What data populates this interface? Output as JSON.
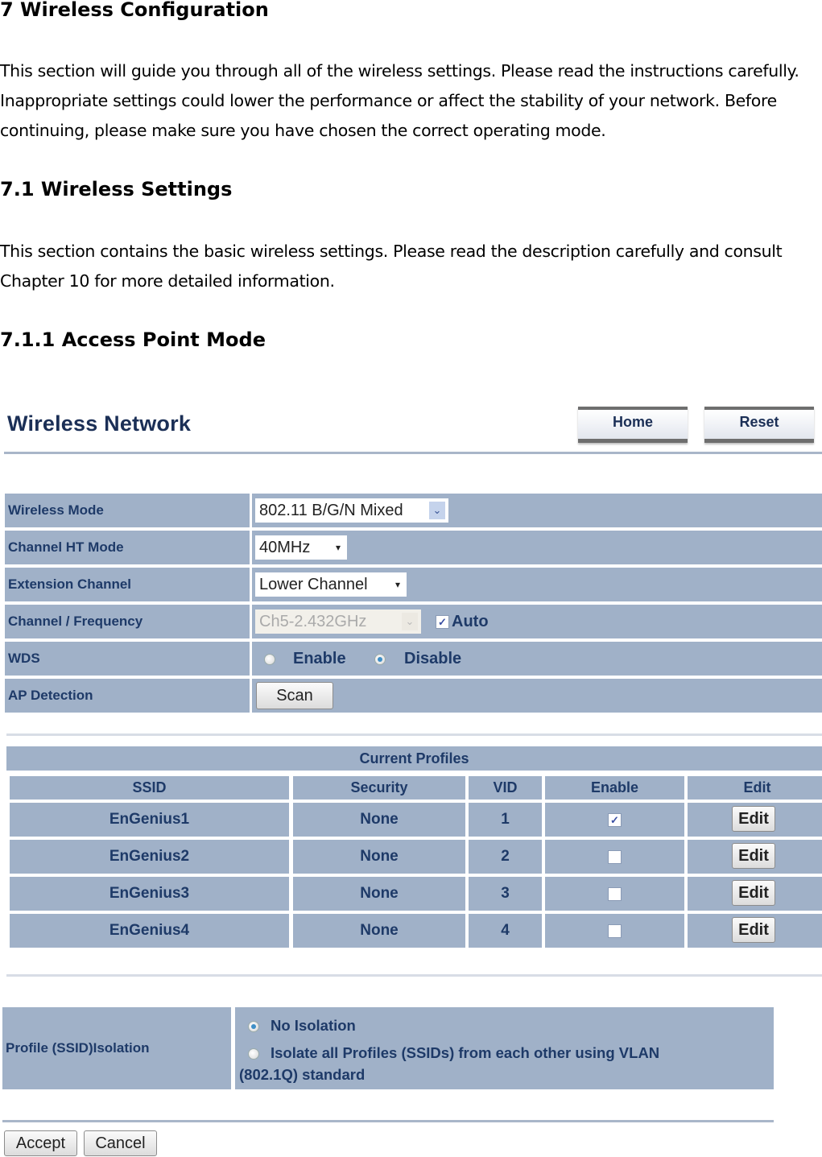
{
  "document": {
    "heading_1": "7 Wireless Configuration",
    "intro_paragraph": "This section will guide you through all of the wireless settings. Please read the instructions carefully. Inappropriate settings could lower the performance or affect the stability of your network. Before continuing, please make sure you have chosen the correct operating mode.",
    "heading_2": "7.1 Wireless Settings",
    "settings_paragraph": "This section contains the basic wireless settings. Please read the description carefully and consult Chapter 10 for more detailed information.",
    "heading_3": "7.1.1 Access Point Mode"
  },
  "ui": {
    "title": "Wireless Network",
    "header_buttons": {
      "home": "Home",
      "reset": "Reset"
    },
    "settings": {
      "wireless_mode": {
        "label": "Wireless Mode",
        "value": "802.11 B/G/N Mixed"
      },
      "channel_ht_mode": {
        "label": "Channel HT Mode",
        "value": "40MHz"
      },
      "extension_channel": {
        "label": "Extension Channel",
        "value": "Lower Channel"
      },
      "channel_frequency": {
        "label": "Channel / Frequency",
        "value": "Ch5-2.432GHz",
        "auto_label": "Auto",
        "auto_checked": true,
        "disabled": true
      },
      "wds": {
        "label": "WDS",
        "options": [
          "Enable",
          "Disable"
        ],
        "selected": "Disable"
      },
      "ap_detection": {
        "label": "AP Detection",
        "button": "Scan"
      }
    },
    "profiles": {
      "title": "Current Profiles",
      "columns": [
        "SSID",
        "Security",
        "VID",
        "Enable",
        "Edit"
      ],
      "rows": [
        {
          "ssid": "EnGenius1",
          "security": "None",
          "vid": "1",
          "enabled": true,
          "edit": "Edit"
        },
        {
          "ssid": "EnGenius2",
          "security": "None",
          "vid": "2",
          "enabled": false,
          "edit": "Edit"
        },
        {
          "ssid": "EnGenius3",
          "security": "None",
          "vid": "3",
          "enabled": false,
          "edit": "Edit"
        },
        {
          "ssid": "EnGenius4",
          "security": "None",
          "vid": "4",
          "enabled": false,
          "edit": "Edit"
        }
      ]
    },
    "isolation": {
      "label": "Profile (SSID)Isolation",
      "options": [
        "No Isolation",
        "Isolate all Profiles (SSIDs) from each other using VLAN",
        "(802.1Q) standard"
      ],
      "selected": "No Isolation"
    },
    "footer_buttons": {
      "accept": "Accept",
      "cancel": "Cancel"
    },
    "icons": {
      "dropdown": "▾",
      "dropdown_blue": "⌄",
      "check": "✓"
    }
  }
}
